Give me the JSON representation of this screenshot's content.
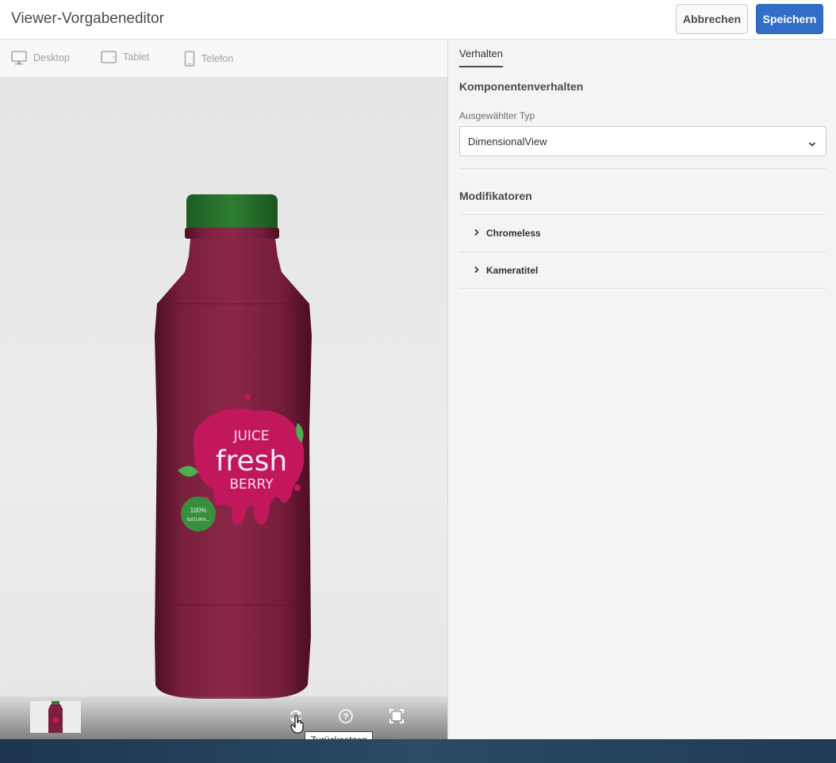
{
  "header": {
    "title": "Viewer-Vorgabeneditor",
    "cancel_label": "Abbrechen",
    "save_label": "Speichern"
  },
  "device_tabs": [
    {
      "label": "Desktop",
      "icon": "desktop-icon"
    },
    {
      "label": "Tablet",
      "icon": "tablet-icon"
    },
    {
      "label": "Telefon",
      "icon": "phone-icon"
    }
  ],
  "viewer": {
    "label_text": {
      "juice": "JUICE",
      "fresh": "fresh",
      "berry": "BERRY",
      "badge_line1": "100%",
      "badge_line2": "NATURA..."
    },
    "controls": [
      "reset-icon",
      "help-icon",
      "fullscreen-icon"
    ],
    "tooltip": "Zurücksetzen"
  },
  "panel": {
    "tab_label": "Verhalten",
    "section_title": "Komponentenverhalten",
    "type_label": "Ausgewählter Typ",
    "type_value": "DimensionalView",
    "modifiers_title": "Modifikatoren",
    "modifiers": [
      "Chromeless",
      "Kameratitel"
    ]
  },
  "colors": {
    "primary": "#326ec8",
    "bottle": "#7a1f3d",
    "cap": "#2e7d32",
    "label_splash": "#c2185b"
  }
}
